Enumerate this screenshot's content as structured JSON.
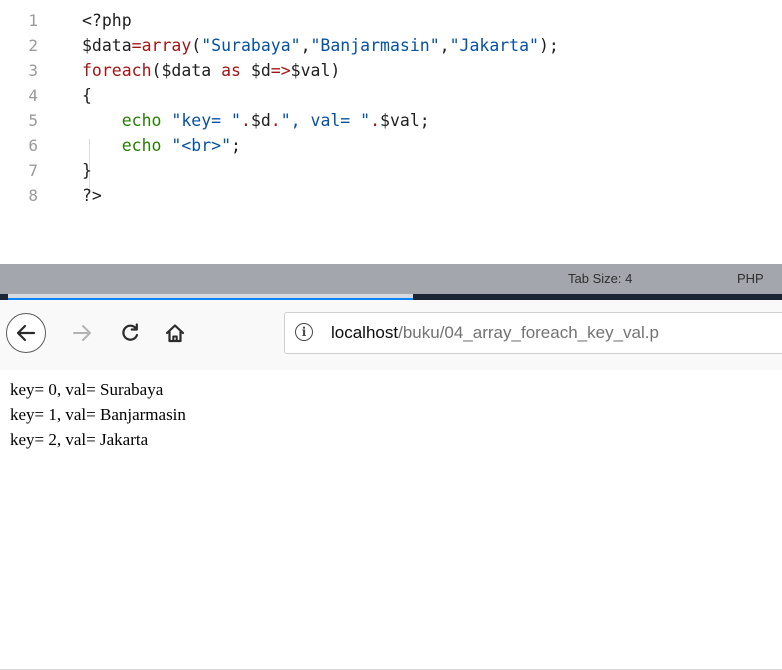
{
  "editor": {
    "lines": [
      {
        "n": "1",
        "tokens": [
          {
            "t": "<?php",
            "c": "plain"
          }
        ]
      },
      {
        "n": "2",
        "tokens": [
          {
            "t": "$data",
            "c": "plain"
          },
          {
            "t": "=",
            "c": "op"
          },
          {
            "t": "array",
            "c": "kw"
          },
          {
            "t": "(",
            "c": "plain"
          },
          {
            "t": "\"Surabaya\"",
            "c": "str"
          },
          {
            "t": ",",
            "c": "plain"
          },
          {
            "t": "\"Banjarmasin\"",
            "c": "str"
          },
          {
            "t": ",",
            "c": "plain"
          },
          {
            "t": "\"Jakarta\"",
            "c": "str"
          },
          {
            "t": ");",
            "c": "plain"
          }
        ]
      },
      {
        "n": "3",
        "tokens": [
          {
            "t": "foreach",
            "c": "kw"
          },
          {
            "t": "($data ",
            "c": "plain"
          },
          {
            "t": "as",
            "c": "kw"
          },
          {
            "t": " $d",
            "c": "plain"
          },
          {
            "t": "=>",
            "c": "op"
          },
          {
            "t": "$val)",
            "c": "plain"
          }
        ]
      },
      {
        "n": "4",
        "tokens": [
          {
            "t": "{",
            "c": "plain"
          }
        ]
      },
      {
        "n": "5",
        "tokens": [
          {
            "t": "    echo ",
            "c": "green"
          },
          {
            "t": "\"key= \"",
            "c": "str"
          },
          {
            "t": ".",
            "c": "op"
          },
          {
            "t": "$d",
            "c": "plain"
          },
          {
            "t": ".",
            "c": "op"
          },
          {
            "t": "\", val= \"",
            "c": "str"
          },
          {
            "t": ".",
            "c": "op"
          },
          {
            "t": "$val;",
            "c": "plain"
          }
        ]
      },
      {
        "n": "6",
        "tokens": [
          {
            "t": "    echo ",
            "c": "green"
          },
          {
            "t": "\"<br>\"",
            "c": "str"
          },
          {
            "t": ";",
            "c": "plain"
          }
        ]
      },
      {
        "n": "7",
        "tokens": [
          {
            "t": "}",
            "c": "plain"
          }
        ]
      },
      {
        "n": "8",
        "tokens": [
          {
            "t": "?>",
            "c": "plain"
          }
        ]
      }
    ]
  },
  "statusbar": {
    "tab_size": "Tab Size: 4",
    "language": "PHP"
  },
  "browser": {
    "info_symbol": "i",
    "url_host": "localhost",
    "url_path": "/buku/04_array_foreach_key_val.p"
  },
  "output": {
    "lines": [
      "key= 0, val= Surabaya",
      "key= 1, val= Banjarmasin",
      "key= 2, val= Jakarta"
    ]
  },
  "colors": {
    "keyword": "#a31515",
    "string": "#0451a5",
    "echo": "#267f00",
    "statusbar": "#a3a6ad",
    "accent": "#0a84ff"
  }
}
